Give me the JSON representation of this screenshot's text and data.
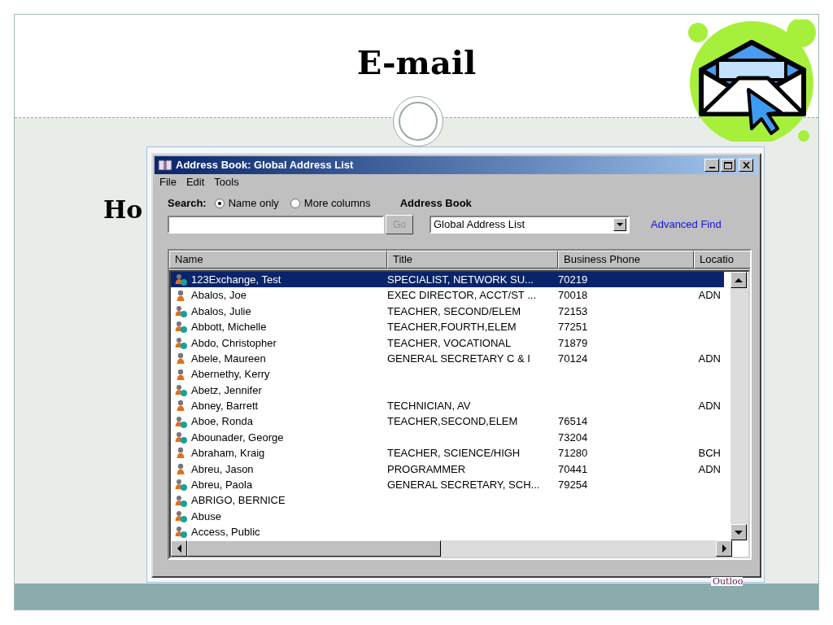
{
  "slide": {
    "title": "E-mail",
    "body_text": "Ho",
    "footer_fragment": "Outloo"
  },
  "window": {
    "title": "Address Book: Global Address List",
    "menu": [
      "File",
      "Edit",
      "Tools"
    ],
    "search": {
      "label": "Search:",
      "options": [
        {
          "label": "Name only",
          "selected": true
        },
        {
          "label": "More columns",
          "selected": false
        }
      ],
      "go_button": "Go",
      "go_disabled": true
    },
    "address_book": {
      "label": "Address Book",
      "value": "Global Address List"
    },
    "advanced_find": "Advanced Find",
    "table": {
      "columns": [
        "Name",
        "Title",
        "Business Phone",
        "Locatio"
      ],
      "rows": [
        {
          "kind": "contact",
          "name": "123Exchange, Test",
          "title": "SPECIALIST, NETWORK SU...",
          "phone": "70219",
          "location": "",
          "selected": true
        },
        {
          "kind": "user",
          "name": "Abalos, Joe",
          "title": "EXEC DIRECTOR, ACCT/ST ...",
          "phone": "70018",
          "location": "ADN",
          "selected": false
        },
        {
          "kind": "contact",
          "name": "Abalos, Julie",
          "title": "TEACHER, SECOND/ELEM",
          "phone": "72153",
          "location": "",
          "selected": false
        },
        {
          "kind": "contact",
          "name": "Abbott, Michelle",
          "title": "TEACHER,FOURTH,ELEM",
          "phone": "77251",
          "location": "",
          "selected": false
        },
        {
          "kind": "contact",
          "name": "Abdo, Christopher",
          "title": "TEACHER, VOCATIONAL",
          "phone": "71879",
          "location": "",
          "selected": false
        },
        {
          "kind": "user",
          "name": "Abele, Maureen",
          "title": "GENERAL SECRETARY C & I",
          "phone": "70124",
          "location": "ADN",
          "selected": false
        },
        {
          "kind": "user",
          "name": "Abernethy, Kerry",
          "title": "",
          "phone": "",
          "location": "",
          "selected": false
        },
        {
          "kind": "contact",
          "name": "Abetz, Jennifer",
          "title": "",
          "phone": "",
          "location": "",
          "selected": false
        },
        {
          "kind": "user",
          "name": "Abney, Barrett",
          "title": "TECHNICIAN, AV",
          "phone": "",
          "location": "ADN",
          "selected": false
        },
        {
          "kind": "contact",
          "name": "Aboe, Ronda",
          "title": "TEACHER,SECOND,ELEM",
          "phone": "76514",
          "location": "",
          "selected": false
        },
        {
          "kind": "contact",
          "name": "Abounader, George",
          "title": "",
          "phone": "73204",
          "location": "",
          "selected": false
        },
        {
          "kind": "user",
          "name": "Abraham, Kraig",
          "title": "TEACHER, SCIENCE/HIGH",
          "phone": "71280",
          "location": "BCH",
          "selected": false
        },
        {
          "kind": "user",
          "name": "Abreu, Jason",
          "title": "PROGRAMMER",
          "phone": "70441",
          "location": "ADN",
          "selected": false
        },
        {
          "kind": "contact",
          "name": "Abreu, Paola",
          "title": "GENERAL SECRETARY, SCH...",
          "phone": "79254",
          "location": "",
          "selected": false
        },
        {
          "kind": "contact",
          "name": "ABRIGO, BERNICE",
          "title": "",
          "phone": "",
          "location": "",
          "selected": false
        },
        {
          "kind": "contact",
          "name": "Abuse",
          "title": "",
          "phone": "",
          "location": "",
          "selected": false
        },
        {
          "kind": "contact",
          "name": "Access, Public",
          "title": "",
          "phone": "",
          "location": "",
          "selected": false
        }
      ]
    }
  }
}
